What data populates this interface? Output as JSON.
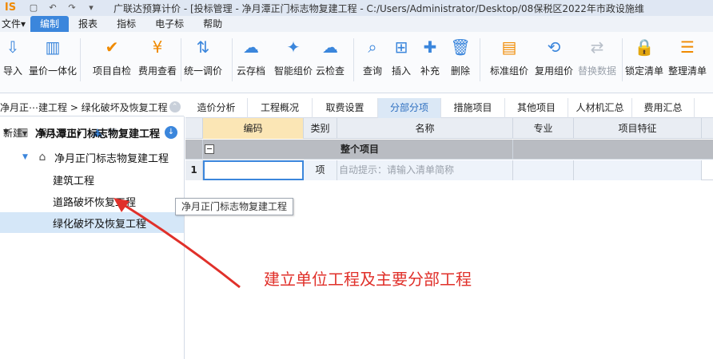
{
  "titlebar": {
    "logo": "IS",
    "title": "广联达预算计价 - [投标管理 - 净月潭正门标志物复建工程 - C:/Users/Administrator/Desktop/08保税区2022年市政设施维"
  },
  "menu": {
    "items": [
      "文件▾",
      "编制",
      "报表",
      "指标",
      "电子标",
      "帮助"
    ],
    "active": "编制"
  },
  "ribbon": {
    "tools": [
      {
        "label": "导入",
        "icon": "import-icon",
        "color": "#3b86dc",
        "disabled": false
      },
      {
        "label": "量价一体化",
        "icon": "quantity-price-icon",
        "color": "#3b86dc",
        "disabled": false
      },
      {
        "label": "项目自检",
        "icon": "self-check-icon",
        "color": "#f08a00",
        "disabled": false
      },
      {
        "label": "费用查看",
        "icon": "cost-view-icon",
        "color": "#f08a00",
        "disabled": false
      },
      {
        "label": "统一调价",
        "icon": "price-adjust-icon",
        "color": "#3b86dc",
        "disabled": false
      },
      {
        "label": "云存档",
        "icon": "cloud-save-icon",
        "color": "#3b86dc",
        "disabled": false
      },
      {
        "label": "智能组价",
        "icon": "smart-price-icon",
        "color": "#3b86dc",
        "disabled": false
      },
      {
        "label": "云检查",
        "icon": "cloud-check-icon",
        "color": "#3b86dc",
        "disabled": false
      },
      {
        "label": "查询",
        "icon": "query-icon",
        "color": "#3b86dc",
        "disabled": false
      },
      {
        "label": "插入",
        "icon": "insert-icon",
        "color": "#3b86dc",
        "disabled": false
      },
      {
        "label": "补充",
        "icon": "supplement-icon",
        "color": "#3b86dc",
        "disabled": false
      },
      {
        "label": "删除",
        "icon": "delete-icon",
        "color": "#3b86dc",
        "disabled": false
      },
      {
        "label": "标准组价",
        "icon": "standard-price-icon",
        "color": "#f08a00",
        "disabled": false
      },
      {
        "label": "复用组价",
        "icon": "reuse-price-icon",
        "color": "#3b86dc",
        "disabled": false
      },
      {
        "label": "替换数据",
        "icon": "replace-data-icon",
        "color": "#b9c0ca",
        "disabled": true
      },
      {
        "label": "锁定清单",
        "icon": "lock-list-icon",
        "color": "#3b86dc",
        "disabled": false
      },
      {
        "label": "整理清单",
        "icon": "organize-list-icon",
        "color": "#f08a00",
        "disabled": false
      }
    ]
  },
  "breadcrumb": {
    "text": "净月正⋯建工程 > 绿化破坏及恢复工程"
  },
  "left_panel": {
    "new_label": "新建▾",
    "import_export_label": "导入导出▾"
  },
  "tree": [
    {
      "label": "净月潭正门标志物复建工程",
      "level": 0,
      "icon": "building-icon",
      "expanded": true,
      "bold": true,
      "selected": false
    },
    {
      "label": "净月正门标志物复建工程",
      "level": 1,
      "icon": "home-icon",
      "expanded": true,
      "bold": false,
      "selected": false
    },
    {
      "label": "建筑工程",
      "level": 2,
      "icon": "",
      "expanded": false,
      "bold": false,
      "selected": false
    },
    {
      "label": "道路破坏恢复工程",
      "level": 2,
      "icon": "",
      "expanded": false,
      "bold": false,
      "selected": false
    },
    {
      "label": "绿化破坏及恢复工程",
      "level": 2,
      "icon": "",
      "expanded": false,
      "bold": false,
      "selected": true
    }
  ],
  "tooltip": "净月正门标志物复建工程",
  "tabs": [
    "造价分析",
    "工程概况",
    "取费设置",
    "分部分项",
    "措施项目",
    "其他项目",
    "人材机汇总",
    "费用汇总"
  ],
  "active_tab": "分部分项",
  "grid": {
    "columns": [
      "编码",
      "类别",
      "名称",
      "专业",
      "项目特征"
    ],
    "group_row": {
      "name": "整个项目"
    },
    "rows": [
      {
        "num": "1",
        "code": "",
        "category": "项",
        "name": "自动提示：请输入清单简称",
        "major": "",
        "feature": ""
      }
    ]
  },
  "annotation": "建立单位工程及主要分部工程"
}
